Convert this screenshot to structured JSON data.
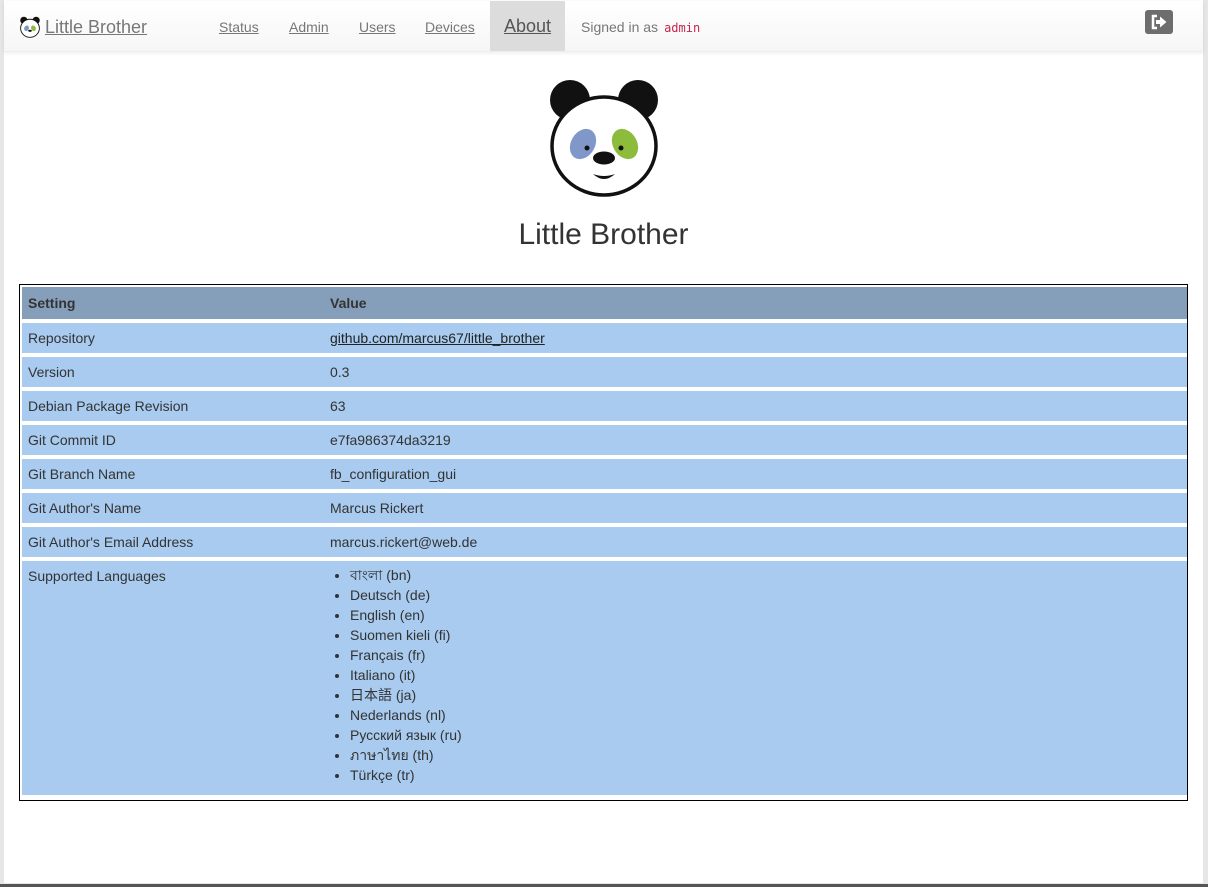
{
  "navbar": {
    "brand": "Little Brother",
    "links": [
      {
        "label": "Status"
      },
      {
        "label": "Admin"
      },
      {
        "label": "Users"
      },
      {
        "label": "Devices"
      }
    ],
    "active": "About",
    "signed_in_prefix": "Signed in as",
    "username": "admin",
    "logout_icon": "sign-out-icon"
  },
  "main": {
    "title": "Little Brother",
    "logo_icon": "panda-logo",
    "table": {
      "headers": [
        "Setting",
        "Value"
      ],
      "rows": [
        {
          "setting": "Repository",
          "value": "github.com/marcus67/little_brother",
          "is_link": true
        },
        {
          "setting": "Version",
          "value": "0.3"
        },
        {
          "setting": "Debian Package Revision",
          "value": "63"
        },
        {
          "setting": "Git Commit ID",
          "value": "e7fa986374da3219"
        },
        {
          "setting": "Git Branch Name",
          "value": "fb_configuration_gui"
        },
        {
          "setting": "Git Author's Name",
          "value": "Marcus Rickert"
        },
        {
          "setting": "Git Author's Email Address",
          "value": "marcus.rickert@web.de"
        }
      ],
      "languages_label": "Supported Languages",
      "languages": [
        "বাংলা (bn)",
        "Deutsch (de)",
        "English (en)",
        "Suomen kieli (fi)",
        "Français (fr)",
        "Italiano (it)",
        "日本語 (ja)",
        "Nederlands (nl)",
        "Русский язык (ru)",
        "ภาษาไทย (th)",
        "Türkçe (tr)"
      ]
    }
  },
  "colors": {
    "header_row": "#859fba",
    "data_row": "#a8cbef",
    "active_tab": "#dcdcdc",
    "username": "#c7254e",
    "eye_left": "#7f97c9",
    "eye_right": "#8dbb3c"
  }
}
